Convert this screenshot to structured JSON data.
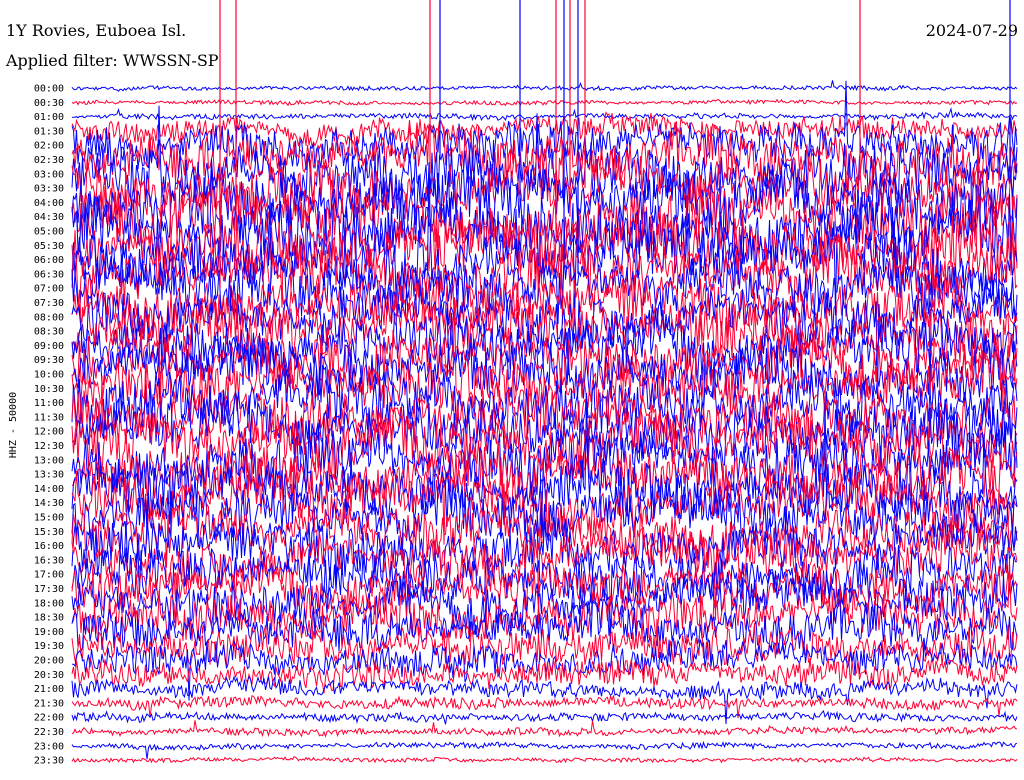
{
  "chart_data": {
    "type": "line",
    "title": "1Y Rovies, Euboea Isl.",
    "date": "2024-07-29",
    "subtitle": "Applied filter: WWSSN-SP",
    "ylabel": "HHZ - 50000",
    "row_labels": [
      "00:00",
      "00:30",
      "01:00",
      "01:30",
      "02:00",
      "02:30",
      "03:00",
      "03:30",
      "04:00",
      "04:30",
      "05:00",
      "05:30",
      "06:00",
      "06:30",
      "07:00",
      "07:30",
      "08:00",
      "08:30",
      "09:00",
      "09:30",
      "10:00",
      "10:30",
      "11:00",
      "11:30",
      "12:00",
      "12:30",
      "13:00",
      "13:30",
      "14:00",
      "14:30",
      "15:00",
      "15:30",
      "16:00",
      "16:30",
      "17:00",
      "17:30",
      "18:00",
      "18:30",
      "19:00",
      "19:30",
      "20:00",
      "20:30",
      "21:00",
      "21:30",
      "22:00",
      "22:30",
      "23:00",
      "23:30"
    ],
    "series": [
      {
        "color": "#0000ff",
        "values": [
          0.15,
          0.15,
          0.2,
          0.8,
          1.4,
          1.7,
          1.9,
          2.0,
          2.1,
          2.1,
          2.2,
          2.1,
          2.0,
          1.9,
          1.9,
          1.8,
          1.8,
          1.8,
          1.8,
          1.8,
          1.8,
          1.8,
          1.9,
          1.9,
          1.9,
          1.9,
          1.9,
          1.8,
          1.8,
          1.8,
          1.8,
          1.7,
          1.7,
          1.6,
          1.6,
          1.5,
          1.5,
          1.5,
          1.4,
          1.3,
          1.1,
          0.9,
          0.6,
          0.4,
          0.3,
          0.25,
          0.2,
          0.15
        ]
      },
      {
        "color": "#ff0033",
        "values": [
          0.15,
          0.15,
          0.2,
          0.8,
          1.4,
          1.7,
          1.9,
          2.0,
          2.1,
          2.1,
          2.2,
          2.1,
          2.0,
          1.9,
          1.9,
          1.8,
          1.8,
          1.8,
          1.8,
          1.8,
          1.8,
          1.8,
          1.9,
          1.9,
          1.9,
          1.9,
          1.9,
          1.8,
          1.8,
          1.8,
          1.8,
          1.7,
          1.7,
          1.6,
          1.6,
          1.5,
          1.5,
          1.5,
          1.4,
          1.3,
          1.1,
          0.9,
          0.6,
          0.4,
          0.3,
          0.25,
          0.2,
          0.15
        ]
      }
    ],
    "row_colors": [
      "#0000ff",
      "#ff0033"
    ],
    "grid": false
  }
}
